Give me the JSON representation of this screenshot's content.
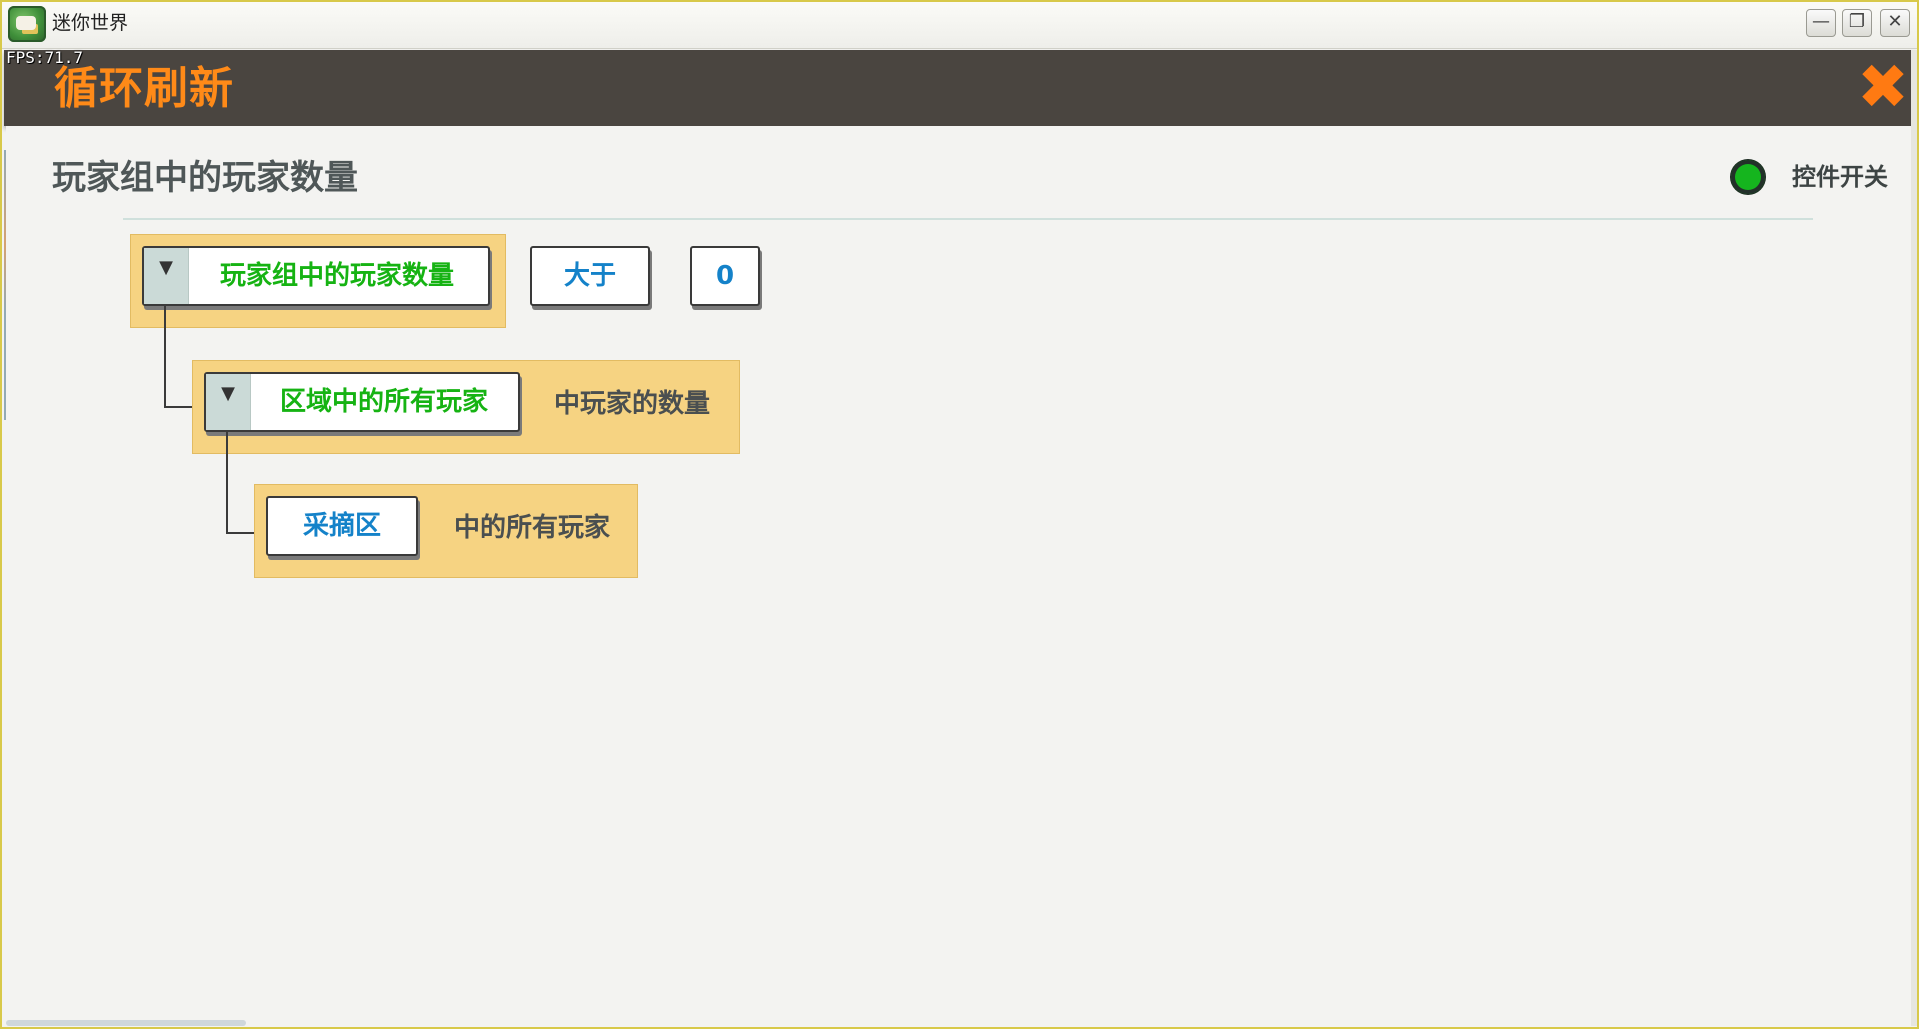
{
  "window": {
    "title": "迷你世界",
    "minimize_glyph": "—",
    "maximize_glyph": "❐",
    "close_glyph": "✕"
  },
  "fps": "FPS:71.7",
  "dialog": {
    "title": "循环刷新",
    "close_glyph": "✖",
    "accent_color": "#ff8a18"
  },
  "section": {
    "title": "玩家组中的玩家数量",
    "toggle_label": "控件开关",
    "toggle_color": "#15b51e"
  },
  "blocks": {
    "row1": {
      "dropdown_label": "玩家组中的玩家数量",
      "operator_label": "大于",
      "value_label": "0"
    },
    "row2": {
      "dropdown_label": "区域中的所有玩家",
      "suffix": "中玩家的数量"
    },
    "row3": {
      "area_label": "采摘区",
      "suffix": "中的所有玩家"
    }
  },
  "icons": {
    "dropdown": "▼"
  }
}
